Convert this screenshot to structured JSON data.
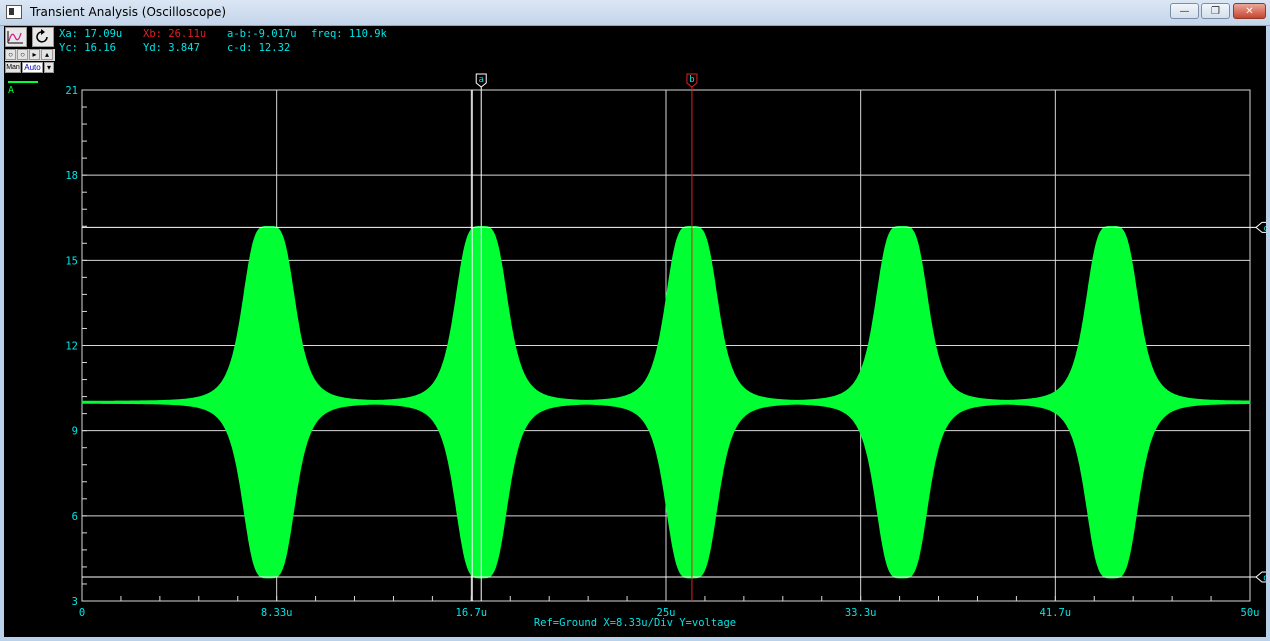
{
  "window": {
    "title": "Transient Analysis (Oscilloscope)",
    "controls": {
      "minimize_icon": "minimize-icon",
      "maximize_icon": "restore-icon",
      "close_icon": "close-icon"
    }
  },
  "toolbar": {
    "buttons": [
      {
        "icon": "waveform-icon"
      },
      {
        "icon": "refresh-icon"
      }
    ],
    "man_label": "Man",
    "auto_label": "Auto"
  },
  "readouts": {
    "xa": "Xa: 17.09u",
    "xb": "Xb: 26.11u",
    "ab": "a-b:-9.017u",
    "freq": "freq: 110.9k",
    "yc": "Yc: 16.16",
    "yd": "Yd: 3.847",
    "cd": "c-d: 12.32"
  },
  "trace_label": "A",
  "footer": "Ref=Ground  X=8.33u/Div Y=voltage",
  "colors": {
    "background": "#000000",
    "grid": "#d8d8d8",
    "trace": "#00ff33",
    "axis_text": "#00e5e5",
    "readout_text": "#00e5e5",
    "cursor_b": "#e02020",
    "cursor_a": "#ffffff"
  },
  "chart_data": {
    "type": "line",
    "title": "",
    "xlabel": "",
    "ylabel": "",
    "xlim": [
      0,
      50
    ],
    "ylim": [
      3,
      21
    ],
    "x_unit": "u",
    "x_ticks": [
      "0",
      "8.33u",
      "16.7u",
      "25u",
      "33.3u",
      "41.7u",
      "50u"
    ],
    "y_ticks": [
      "3",
      "6",
      "9",
      "12",
      "15",
      "18",
      "21"
    ],
    "series": [
      {
        "waveform": "burst envelope",
        "baseline": 10,
        "peak_max": 16.16,
        "peak_min": 3.847,
        "burst_centers": [
          8.0,
          17.1,
          26.1,
          35.1,
          44.1
        ]
      }
    ],
    "cursors": {
      "a": {
        "label": "a",
        "x": 17.09
      },
      "b": {
        "label": "b",
        "x": 26.11
      },
      "c": {
        "label": "c",
        "y": 16.16
      },
      "d": {
        "label": "d",
        "y": 3.847
      }
    }
  }
}
